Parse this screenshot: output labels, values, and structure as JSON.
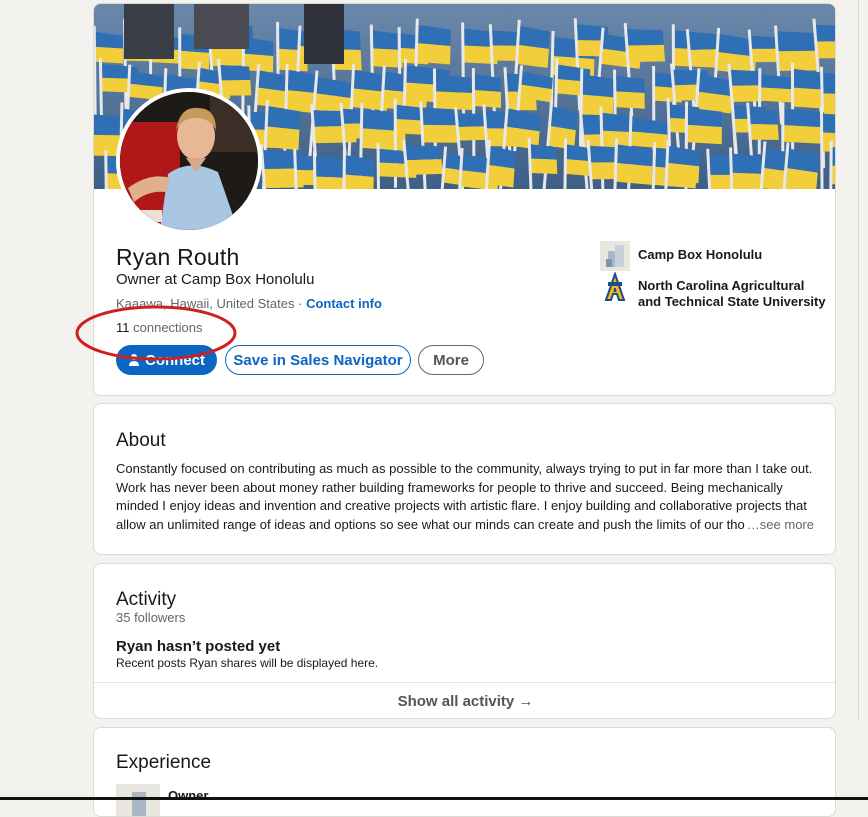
{
  "profile": {
    "name": "Ryan Routh",
    "headline": "Owner at Camp Box Honolulu",
    "location": "Kaaawa, Hawaii, United States",
    "separator": "·",
    "contact_info_label": "Contact info",
    "connections_count": "11",
    "connections_label": "connections",
    "actions": {
      "connect_label": "Connect",
      "sales_navigator_label": "Save in Sales Navigator",
      "more_label": "More"
    },
    "organizations": [
      {
        "name": "Camp Box Honolulu",
        "icon": "company-logo-icon"
      },
      {
        "name_line1": "North Carolina Agricultural",
        "name_line2": "and Technical State University",
        "icon": "university-logo-icon"
      }
    ]
  },
  "about": {
    "title": "About",
    "text": "Constantly focused on contributing as much as possible to the community, always trying to put in far more than I take out. Work has never been about money rather building frameworks for people to thrive and succeed. Being mechanically minded I enjoy ideas and invention and creative projects with artistic flare. I enjoy building and collaborative projects that allow an unlimited range of ideas and options so see what our minds can create and push the limits of our thou",
    "see_more_label": "…see more"
  },
  "activity": {
    "title": "Activity",
    "followers": "35 followers",
    "empty_title": "Ryan hasn’t posted yet",
    "empty_subtitle": "Recent posts Ryan shares will be displayed here.",
    "show_all_label": "Show all activity →"
  },
  "experience": {
    "title": "Experience",
    "first_role": "Owner"
  },
  "colors": {
    "accent": "#0a66c2",
    "annotation": "#d01f1f",
    "flag_blue": "#2f6fb5",
    "flag_yellow": "#f2cf3a"
  }
}
